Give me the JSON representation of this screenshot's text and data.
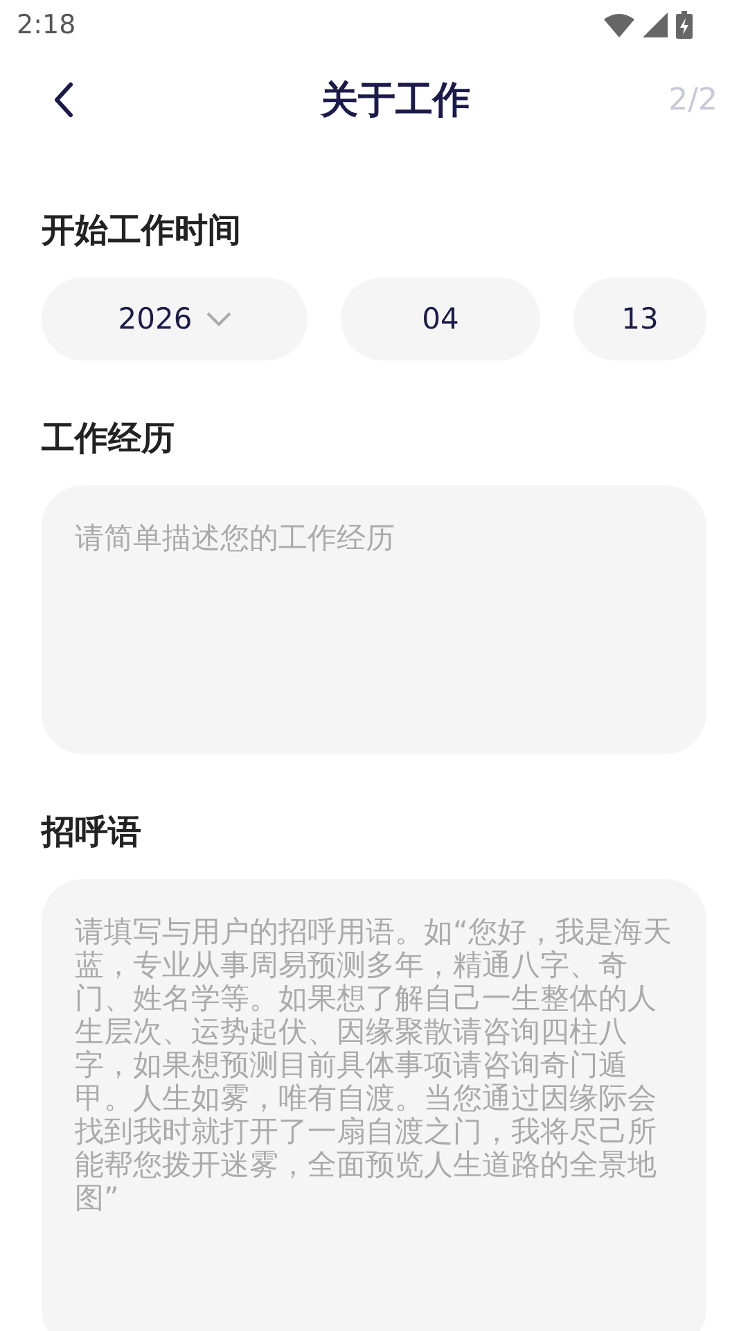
{
  "status_bar": {
    "time": "2:18"
  },
  "header": {
    "title": "关于工作",
    "step": "2/2"
  },
  "sections": [
    {
      "kind": "date",
      "label": "开始工作时间",
      "fields": [
        {
          "value": "2026",
          "dropdown": true
        },
        {
          "value": "04",
          "dropdown": false
        },
        {
          "value": "13",
          "dropdown": false
        }
      ]
    },
    {
      "kind": "text",
      "label": "工作经历",
      "placeholder": "请简单描述您的工作经历"
    },
    {
      "kind": "text",
      "label": "招呼语",
      "placeholder": "请填写与用户的招呼用语。如“您好，我是海天蓝，专业从事周易预测多年，精通八字、奇门、姓名学等。如果想了解自己一生整体的人生层次、运势起伏、因缘聚散请咨询四柱八字，如果想预测目前具体事项请咨询奇门遁甲。人生如雾，唯有自渡。当您通过因缘际会找到我时就打开了一扇自渡之门，我将尽己所能帮您拨开迷雾，全面预览人生道路的全景地图”"
    }
  ]
}
